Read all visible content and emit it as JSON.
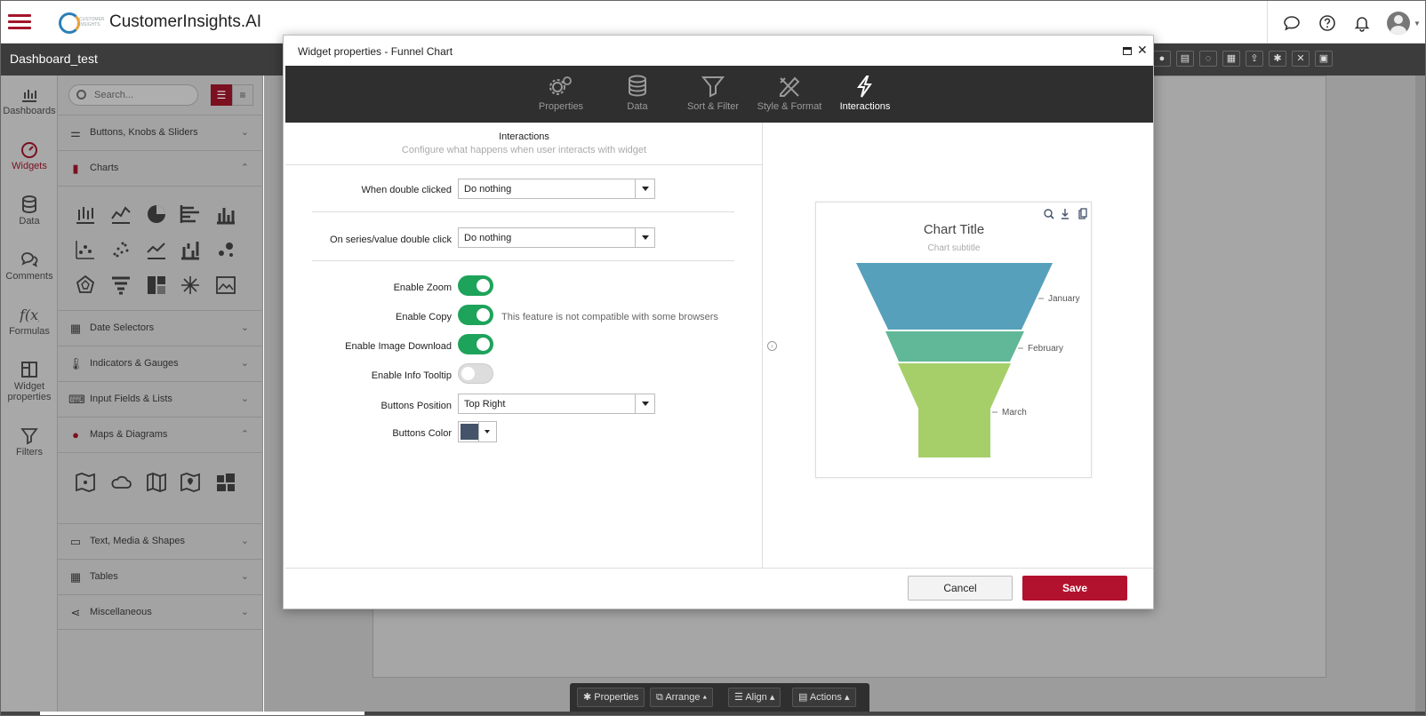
{
  "app": {
    "title": "CustomerInsights.AI",
    "logo_sub": "CUSTOMER INSIGHTS"
  },
  "dashboard": {
    "title": "Dashboard_test"
  },
  "nav": [
    {
      "label": "Dashboards",
      "icon": "bar-chart-icon"
    },
    {
      "label": "Widgets",
      "icon": "gauge-icon"
    },
    {
      "label": "Data",
      "icon": "database-icon"
    },
    {
      "label": "Comments",
      "icon": "comments-icon"
    },
    {
      "label": "Formulas",
      "icon": "formula-icon"
    },
    {
      "label": "Widget properties",
      "icon": "widget-properties-icon"
    },
    {
      "label": "Filters",
      "icon": "filter-icon"
    }
  ],
  "panel": {
    "search_placeholder": "Search...",
    "sections": [
      "Buttons, Knobs & Sliders",
      "Charts",
      "Date Selectors",
      "Indicators & Gauges",
      "Input Fields & Lists",
      "Maps & Diagrams",
      "Text, Media & Shapes",
      "Tables",
      "Miscellaneous"
    ]
  },
  "bottom_toolbar": [
    "Properties",
    "Arrange",
    "Align",
    "Actions"
  ],
  "modal": {
    "title": "Widget properties - Funnel Chart",
    "tabs": [
      "Properties",
      "Data",
      "Sort & Filter",
      "Style & Format",
      "Interactions"
    ],
    "active_tab": "Interactions",
    "section_title": "Interactions",
    "section_subtitle": "Configure what happens when user interacts with widget",
    "fields": {
      "double_click_label": "When double clicked",
      "double_click_value": "Do nothing",
      "series_click_label": "On series/value double click",
      "series_click_value": "Do nothing",
      "zoom_label": "Enable Zoom",
      "zoom_on": true,
      "copy_label": "Enable Copy",
      "copy_on": true,
      "copy_note": "This feature is not compatible with some browsers",
      "image_download_label": "Enable Image Download",
      "image_download_on": true,
      "info_tooltip_label": "Enable Info Tooltip",
      "info_tooltip_on": false,
      "buttons_position_label": "Buttons Position",
      "buttons_position_value": "Top Right",
      "buttons_color_label": "Buttons Color",
      "buttons_color_value": "#45536a"
    },
    "cancel_label": "Cancel",
    "save_label": "Save"
  },
  "chart_data": {
    "type": "funnel",
    "title": "Chart Title",
    "subtitle": "Chart subtitle",
    "categories": [
      "January",
      "February",
      "March"
    ],
    "colors": [
      "#56a0bb",
      "#61b898",
      "#a6cf6a"
    ]
  },
  "colors": {
    "accent": "#b3122e",
    "toggle_on": "#1ea35a",
    "tabbar": "#2f2f2f"
  }
}
